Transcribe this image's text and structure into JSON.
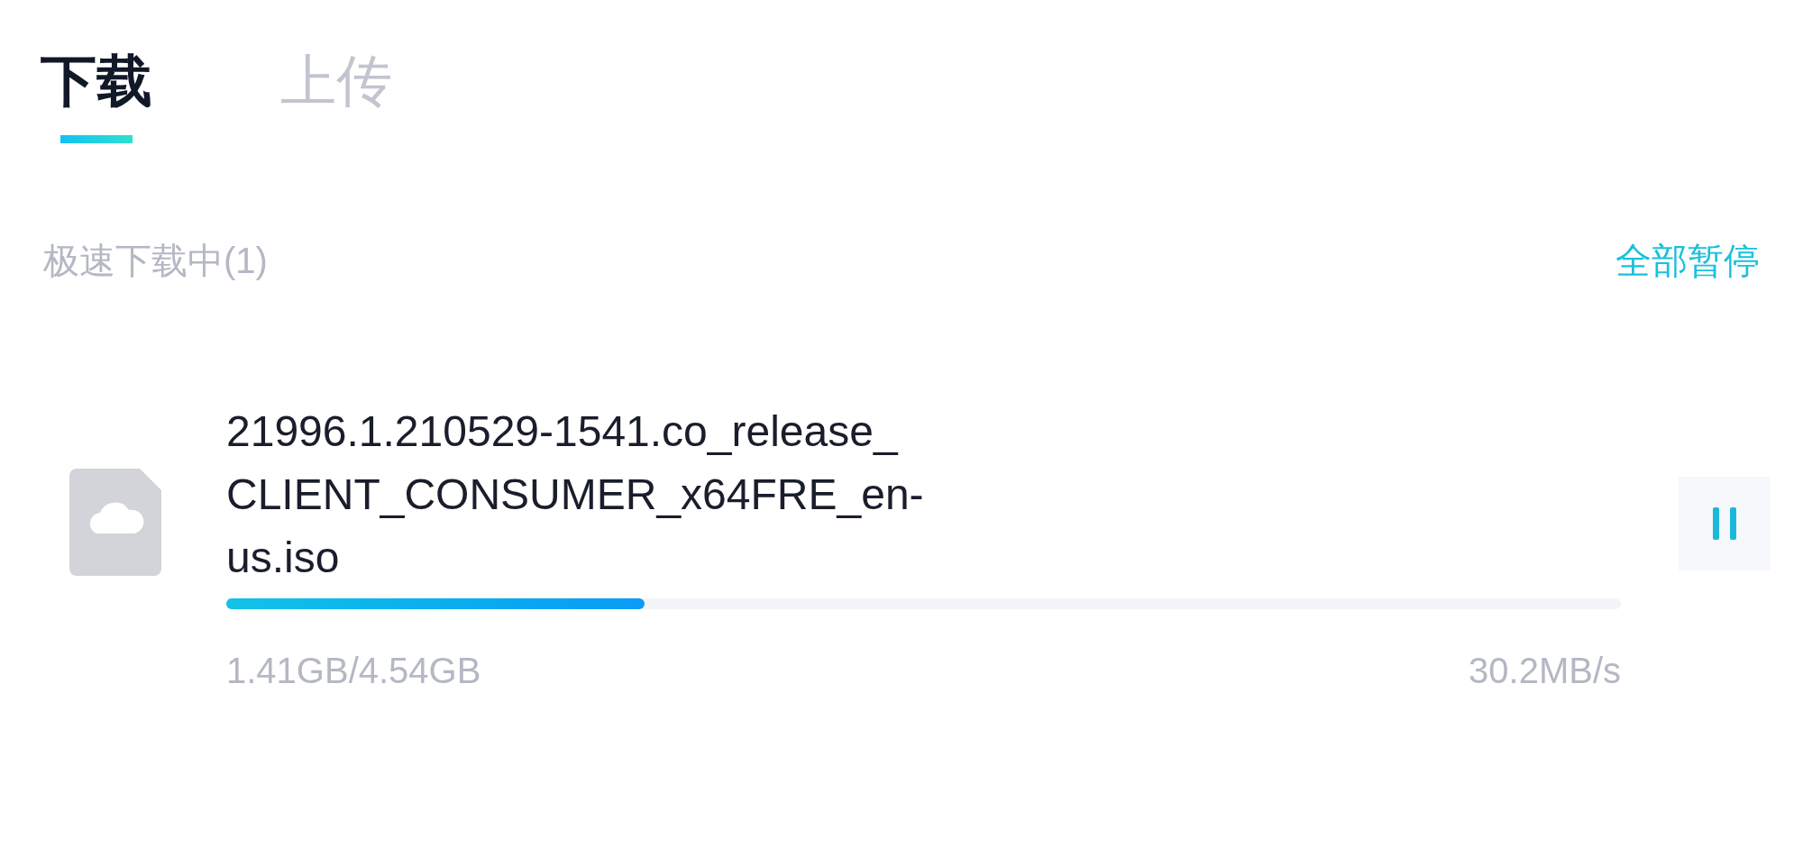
{
  "tabs": [
    {
      "label": "下载",
      "selected": true
    },
    {
      "label": "上传",
      "selected": false
    }
  ],
  "section": {
    "title": "极速下载中(1)",
    "action": "全部暂停"
  },
  "downloads": [
    {
      "name_lines": [
        "21996.1.210529-1541.co_release_",
        "CLIENT_CONSUMER_x64FRE_en-",
        "us.iso"
      ],
      "level": 0.3,
      "size": "1.41GB/4.54GB",
      "speed": "30.2MB/s",
      "paused": false
    }
  ]
}
